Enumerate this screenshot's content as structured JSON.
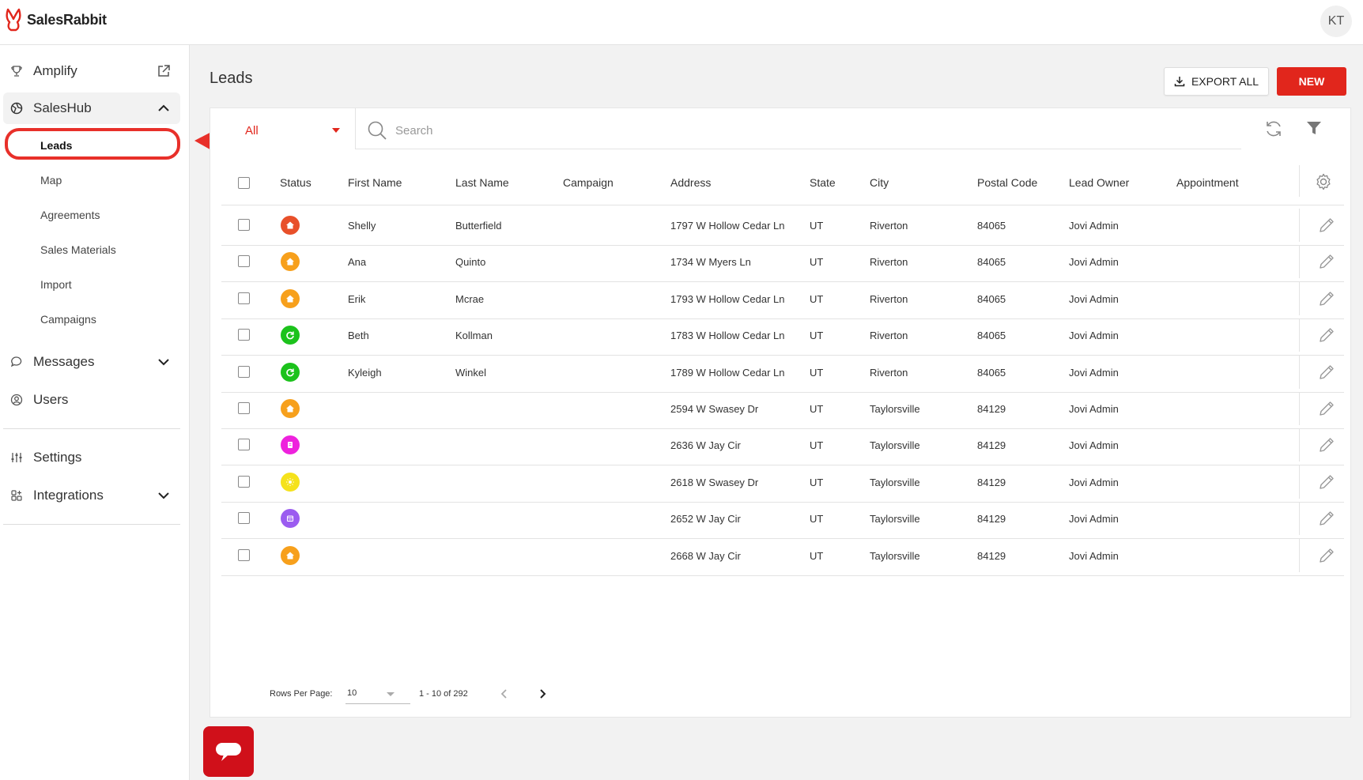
{
  "app": {
    "brand": "SalesRabbit",
    "user_initials": "KT",
    "accent": "#e1261c"
  },
  "sidebar": {
    "items": [
      {
        "label": "Amplify",
        "icon": "trophy-icon",
        "right_icon": "external-link-icon"
      },
      {
        "label": "SalesHub",
        "icon": "globe-icon",
        "right_icon": "chevron-up-icon"
      },
      {
        "label": "Messages",
        "icon": "chat-bubble-icon",
        "right_icon": "chevron-down-icon"
      },
      {
        "label": "Users",
        "icon": "user-circle-icon"
      },
      {
        "label": "Settings",
        "icon": "sliders-icon"
      },
      {
        "label": "Integrations",
        "icon": "grid-icon",
        "right_icon": "chevron-down-icon"
      }
    ],
    "subitems": [
      "Leads",
      "Map",
      "Agreements",
      "Sales Materials",
      "Import",
      "Campaigns"
    ]
  },
  "main": {
    "title": "Leads",
    "export_label": "EXPORT ALL",
    "new_label": "NEW",
    "filter_value": "All",
    "search_placeholder": "Search"
  },
  "table": {
    "columns": [
      "Status",
      "First Name",
      "Last Name",
      "Campaign",
      "Address",
      "State",
      "City",
      "Postal Code",
      "Lead Owner",
      "Appointment"
    ],
    "rows": [
      {
        "status_color": "#e8502a",
        "status_icon": "home-icon",
        "first": "Shelly",
        "last": "Butterfield",
        "campaign": "",
        "address": "1797 W Hollow Cedar Ln",
        "state": "UT",
        "city": "Riverton",
        "postal": "84065",
        "owner": "Jovi Admin",
        "appointment": ""
      },
      {
        "status_color": "#f7a01c",
        "status_icon": "home-icon",
        "first": "Ana",
        "last": "Quinto",
        "campaign": "",
        "address": "1734 W Myers Ln",
        "state": "UT",
        "city": "Riverton",
        "postal": "84065",
        "owner": "Jovi Admin",
        "appointment": ""
      },
      {
        "status_color": "#f7a01c",
        "status_icon": "home-icon",
        "first": "Erik",
        "last": "Mcrae",
        "campaign": "",
        "address": "1793 W Hollow Cedar Ln",
        "state": "UT",
        "city": "Riverton",
        "postal": "84065",
        "owner": "Jovi Admin",
        "appointment": ""
      },
      {
        "status_color": "#1cc21c",
        "status_icon": "refresh-icon",
        "first": "Beth",
        "last": "Kollman",
        "campaign": "",
        "address": "1783 W Hollow Cedar Ln",
        "state": "UT",
        "city": "Riverton",
        "postal": "84065",
        "owner": "Jovi Admin",
        "appointment": ""
      },
      {
        "status_color": "#1cc21c",
        "status_icon": "refresh-icon",
        "first": "Kyleigh",
        "last": "Winkel",
        "campaign": "",
        "address": "1789 W Hollow Cedar Ln",
        "state": "UT",
        "city": "Riverton",
        "postal": "84065",
        "owner": "Jovi Admin",
        "appointment": ""
      },
      {
        "status_color": "#f7a01c",
        "status_icon": "home-icon",
        "first": "",
        "last": "",
        "campaign": "",
        "address": "2594 W Swasey Dr",
        "state": "UT",
        "city": "Taylorsville",
        "postal": "84129",
        "owner": "Jovi Admin",
        "appointment": ""
      },
      {
        "status_color": "#ee22dd",
        "status_icon": "document-icon",
        "first": "",
        "last": "",
        "campaign": "",
        "address": "2636 W Jay Cir",
        "state": "UT",
        "city": "Taylorsville",
        "postal": "84129",
        "owner": "Jovi Admin",
        "appointment": ""
      },
      {
        "status_color": "#f5e21c",
        "status_icon": "sun-icon",
        "first": "",
        "last": "",
        "campaign": "",
        "address": "2618 W Swasey Dr",
        "state": "UT",
        "city": "Taylorsville",
        "postal": "84129",
        "owner": "Jovi Admin",
        "appointment": ""
      },
      {
        "status_color": "#9b5cf0",
        "status_icon": "calendar-icon",
        "first": "",
        "last": "",
        "campaign": "",
        "address": "2652 W Jay Cir",
        "state": "UT",
        "city": "Taylorsville",
        "postal": "84129",
        "owner": "Jovi Admin",
        "appointment": ""
      },
      {
        "status_color": "#f7a01c",
        "status_icon": "home-icon",
        "first": "",
        "last": "",
        "campaign": "",
        "address": "2668 W Jay Cir",
        "state": "UT",
        "city": "Taylorsville",
        "postal": "84129",
        "owner": "Jovi Admin",
        "appointment": ""
      }
    ]
  },
  "pagination": {
    "rows_per_page_label": "Rows Per Page:",
    "rows_per_page": "10",
    "range": "1 - 10 of 292"
  }
}
